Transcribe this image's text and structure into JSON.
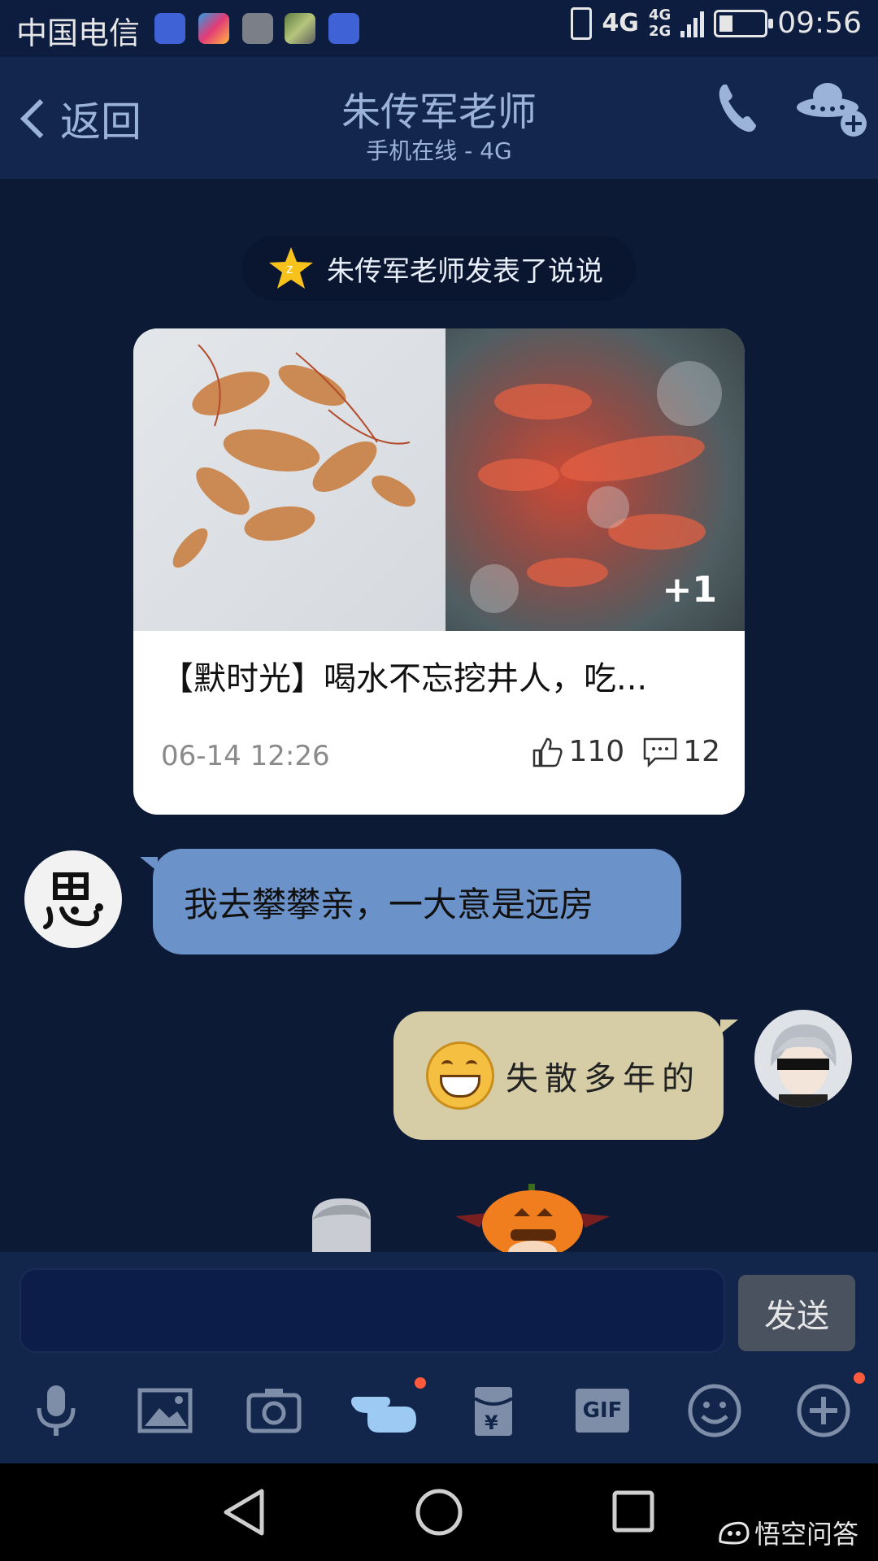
{
  "status_bar": {
    "carrier": "中国电信",
    "network_primary": "4G",
    "network_secondary_top": "4G",
    "network_secondary_bottom": "2G",
    "time": "09:56"
  },
  "header": {
    "back_label": "返回",
    "title": "朱传军老师",
    "subtitle": "手机在线 - 4G"
  },
  "chat": {
    "system_notice": "朱传军老师发表了说说",
    "post_card": {
      "extra_images": "+1",
      "title": "【默时光】喝水不忘挖井人，吃...",
      "date": "06-14 12:26",
      "likes": "110",
      "comments": "12"
    },
    "messages": [
      {
        "side": "left",
        "text": "我去攀攀亲，一大意是远房"
      },
      {
        "side": "right",
        "text": "失散多年的"
      }
    ]
  },
  "input": {
    "send_label": "发送"
  },
  "toolbar": {
    "items": [
      "microphone-icon",
      "image-icon",
      "camera-icon",
      "poke-icon",
      "red-packet-icon",
      "gif-icon",
      "emoji-icon",
      "plus-icon"
    ],
    "gif_label": "GIF"
  },
  "watermark": {
    "text": "悟空问答"
  },
  "colors": {
    "background": "#0c1a36",
    "header": "#13264e",
    "bubble_left": "#6b92c9",
    "bubble_right": "#d6cda7",
    "send_button": "#4a5260"
  }
}
